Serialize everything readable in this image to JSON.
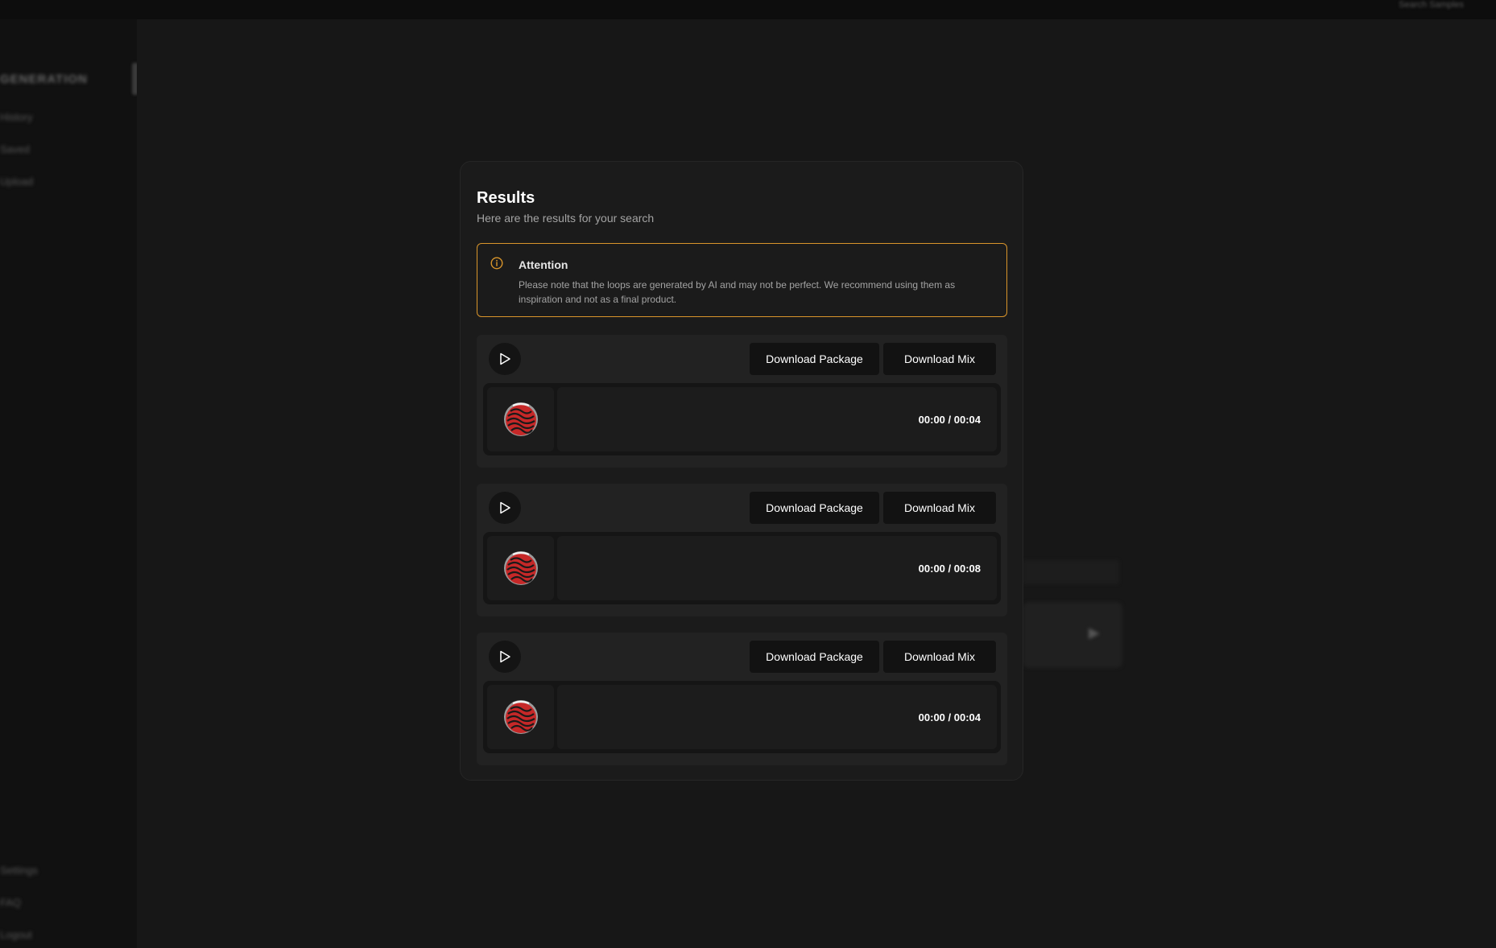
{
  "app": {
    "brand": "GENERATION",
    "topbar_right": "Search Samples",
    "sidebar": {
      "top_items": [
        {
          "label": "History"
        },
        {
          "label": "Saved"
        },
        {
          "label": "Upload"
        }
      ],
      "bottom_items": [
        {
          "label": "Settings"
        },
        {
          "label": "FAQ"
        },
        {
          "label": "Logout"
        }
      ]
    }
  },
  "modal": {
    "title": "Results",
    "subtitle": "Here are the results for your search",
    "alert": {
      "icon": "info-circle-icon",
      "title": "Attention",
      "text": "Please note that the loops are generated by AI and may not be perfect. We recommend using them as inspiration and not as a final product.",
      "border_color": "#d9952b"
    },
    "results": [
      {
        "download_package": "Download Package",
        "download_mix": "Download Mix",
        "time": "00:00 / 00:04"
      },
      {
        "download_package": "Download Package",
        "download_mix": "Download Mix",
        "time": "00:00 / 00:08"
      },
      {
        "download_package": "Download Package",
        "download_mix": "Download Mix",
        "time": "00:00 / 00:04"
      }
    ]
  },
  "colors": {
    "accent_warning": "#d9952b",
    "cover_red": "#c62828",
    "background": "#141414"
  }
}
